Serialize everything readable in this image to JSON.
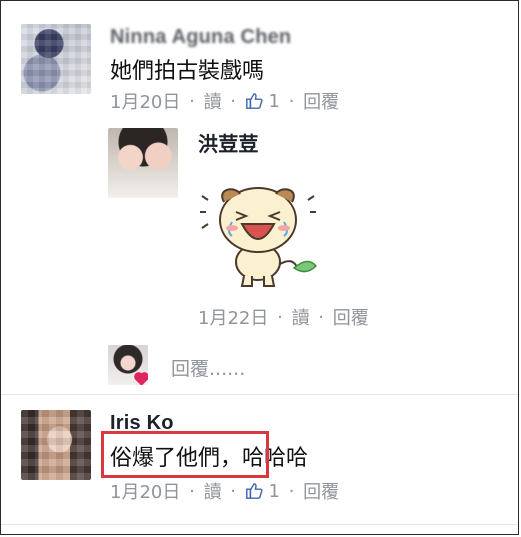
{
  "comments": [
    {
      "name": "Ninna Aguna Chen",
      "text": "她們拍古裝戲嗎",
      "date": "1月20日",
      "read_label": "讀",
      "like_count": "1",
      "reply_label": "回覆",
      "reply": {
        "name": "洪荳荳",
        "sticker": "crying-laughing-dog-sticker",
        "date": "1月22日",
        "read_label": "讀",
        "reply_label": "回覆"
      },
      "reply_prompt": "回覆......"
    },
    {
      "name": "Iris Ko",
      "text_highlight": "俗爆了他們，",
      "text_rest": "哈哈哈",
      "date": "1月20日",
      "read_label": "讀",
      "like_count": "1",
      "reply_label": "回覆"
    }
  ],
  "separator": "·",
  "colors": {
    "meta": "#90949c",
    "like_blue": "#4267b2",
    "highlight_border": "#d8393f",
    "name": "#1d2129"
  },
  "icons": {
    "like": "thumbs-up-icon",
    "reaction": "heart-icon"
  }
}
